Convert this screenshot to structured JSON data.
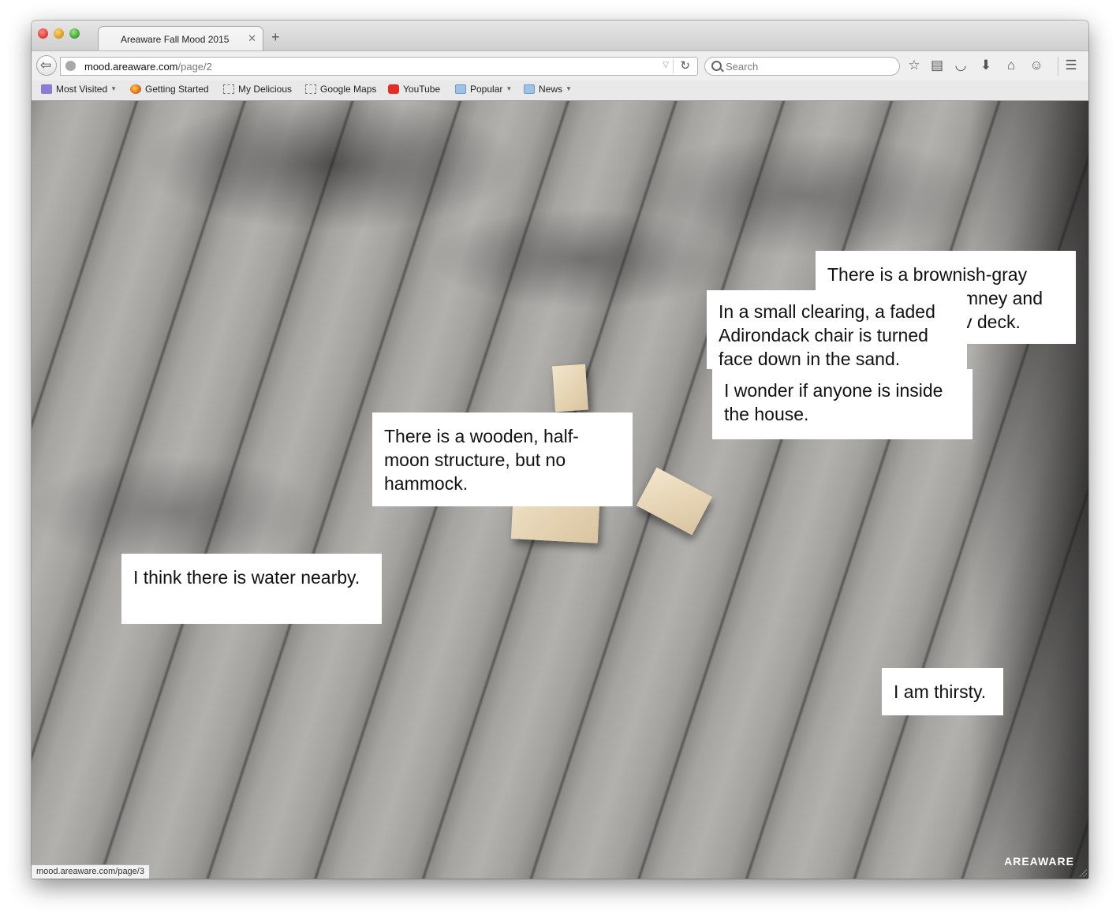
{
  "browser": {
    "tab": {
      "title": "Areaware Fall Mood 2015",
      "close_glyph": "✕"
    },
    "new_tab_glyph": "+",
    "url": {
      "host": "mood.areaware.com",
      "path": "/page/2"
    },
    "search_placeholder": "Search",
    "bookmarks": [
      {
        "label": "Most Visited",
        "icon": "folder-purple",
        "dropdown": true
      },
      {
        "label": "Getting Started",
        "icon": "firefox-icon",
        "dropdown": false
      },
      {
        "label": "My Delicious",
        "icon": "page",
        "dropdown": false
      },
      {
        "label": "Google Maps",
        "icon": "page",
        "dropdown": false
      },
      {
        "label": "YouTube",
        "icon": "youtube-icon",
        "dropdown": false
      },
      {
        "label": "Popular",
        "icon": "folder",
        "dropdown": true
      },
      {
        "label": "News",
        "icon": "folder",
        "dropdown": true
      }
    ],
    "toolbar_icons": [
      "star-icon",
      "reading-list-icon",
      "pocket-icon",
      "download-icon",
      "home-icon",
      "chat-icon",
      "hamburger-menu-icon"
    ],
    "status_url": "mood.areaware.com/page/3"
  },
  "page": {
    "notes": [
      "There is a brownish-gray",
      "mney and",
      "v deck.",
      "In a small clearing, a faded Adirondack chair is turned face down in the sand.",
      "I wonder if anyone is inside the house.",
      "There is a wooden, half-moon structure, but no hammock.",
      "I think there is water nearby.",
      "I am thirsty."
    ],
    "brand": "AREAWARE"
  }
}
